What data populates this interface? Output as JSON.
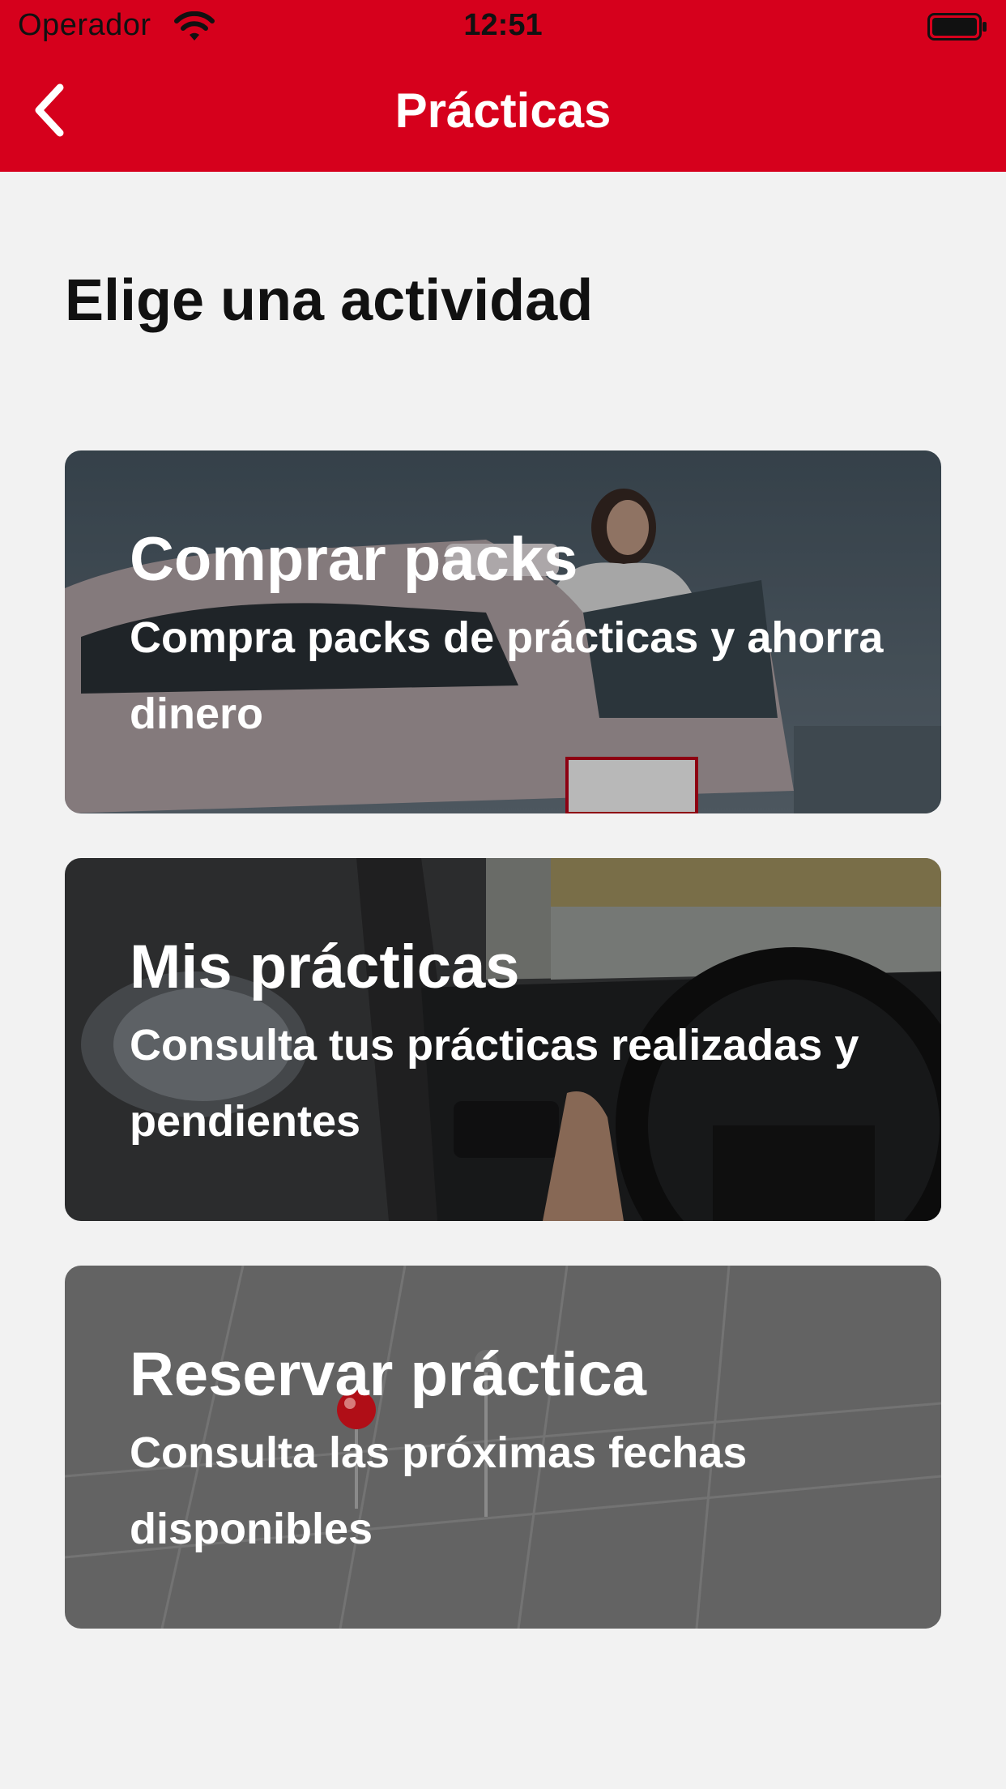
{
  "status_bar": {
    "carrier": "Operador",
    "time": "12:51",
    "wifi_icon": "wifi-icon",
    "battery_icon": "battery-full-icon"
  },
  "nav": {
    "title": "Prácticas",
    "back_icon": "chevron-left-icon"
  },
  "colors": {
    "brand_red": "#d6001c",
    "background": "#f2f2f2"
  },
  "main": {
    "heading": "Elige una actividad",
    "cards": [
      {
        "title": "Comprar packs",
        "subtitle": "Compra packs de prácticas y ahorra dinero",
        "image": "branded-car-with-woman-photo"
      },
      {
        "title": "Mis prácticas",
        "subtitle": "Consulta tus prácticas realizadas y pendientes",
        "image": "car-interior-steering-wheel-photo"
      },
      {
        "title": "Reservar práctica",
        "subtitle": "Consulta las próximas fechas disponibles",
        "image": "calendar-with-pins-photo"
      }
    ]
  }
}
